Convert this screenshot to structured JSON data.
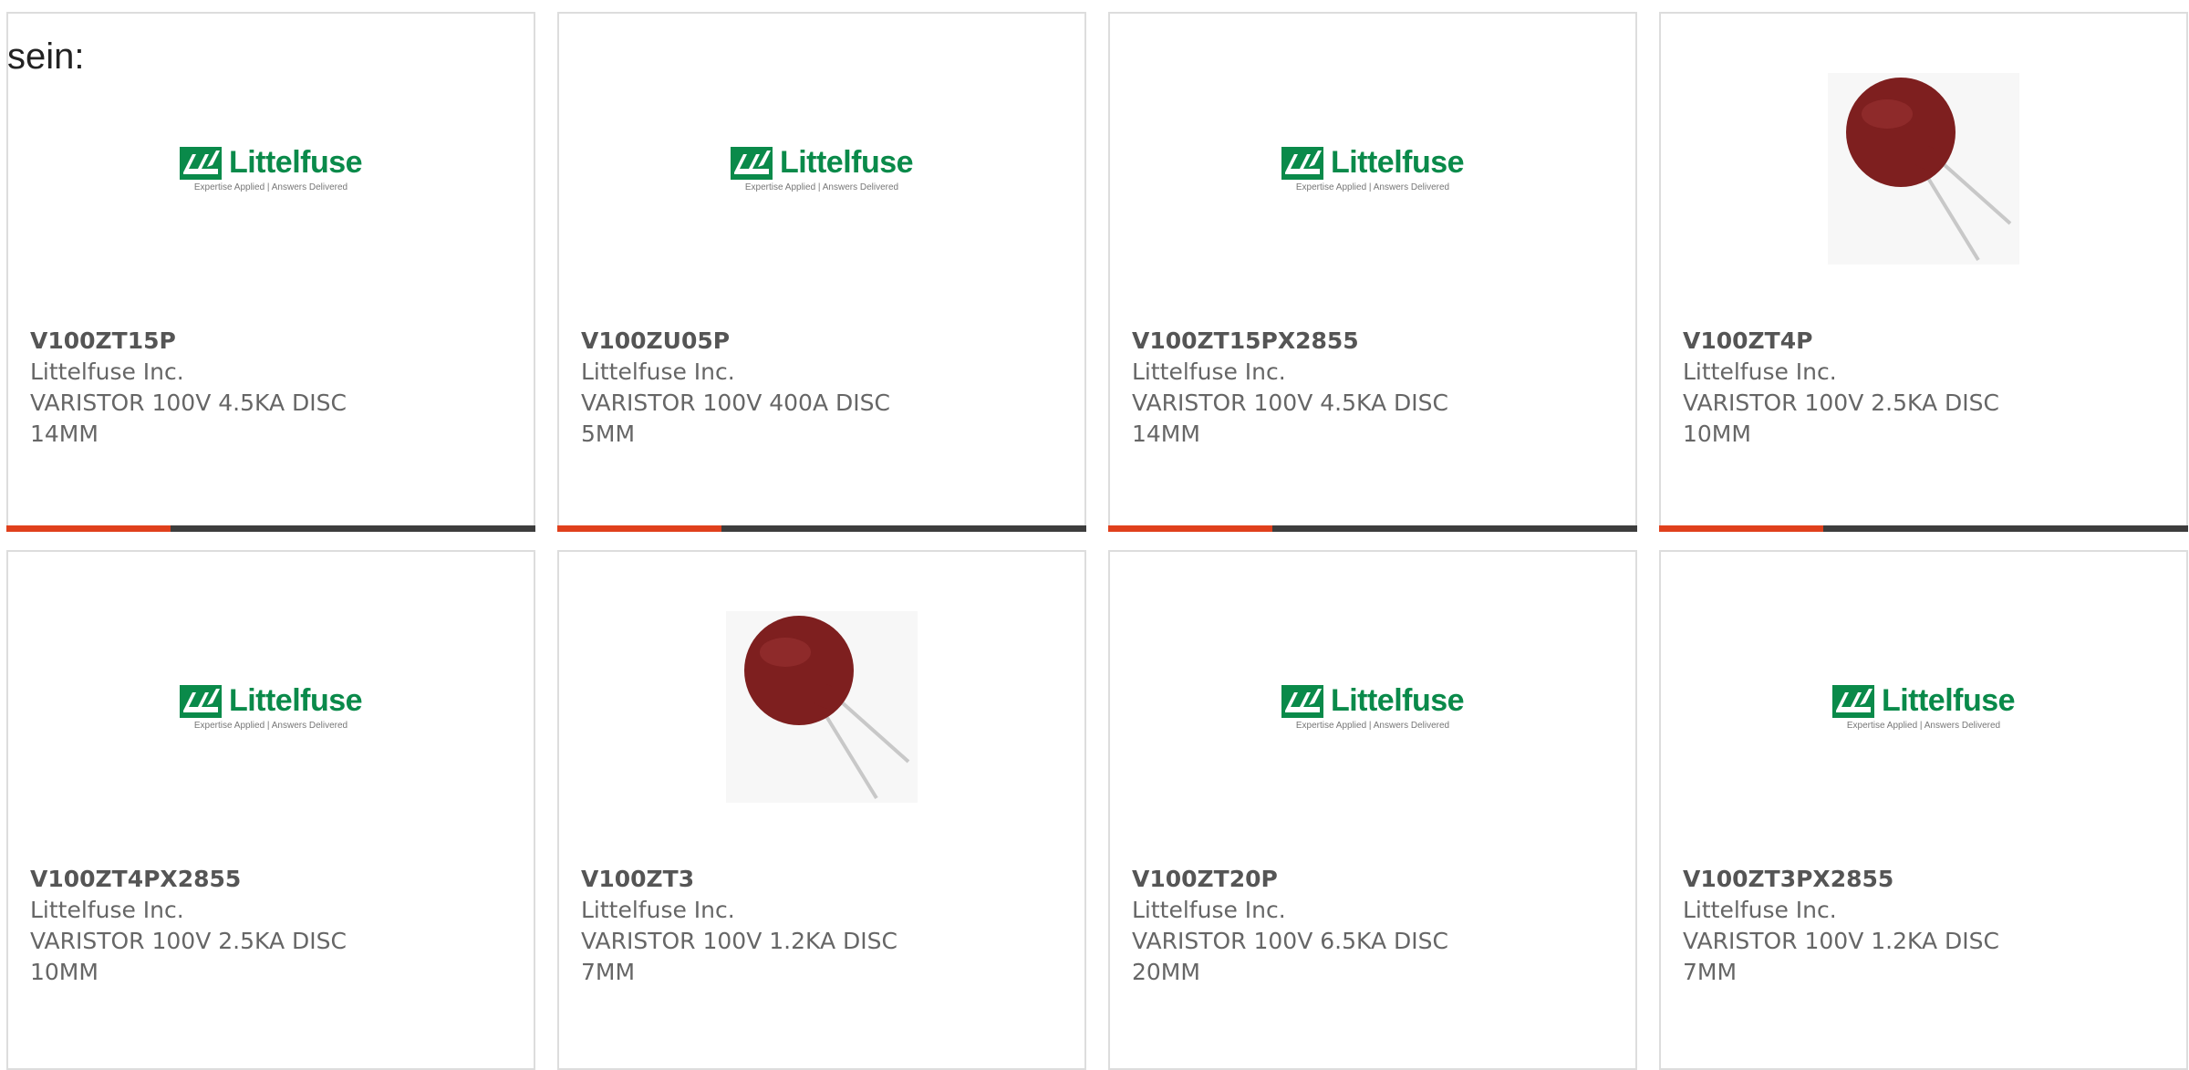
{
  "intro_text": "sein:",
  "accent_color": "#e0401c",
  "brand_color": "#0a8a4a",
  "logo": {
    "word": "Littelfuse",
    "tagline": "Expertise Applied | Answers Delivered"
  },
  "products": [
    {
      "part": "V100ZT15P",
      "mfr": "Littelfuse Inc.",
      "desc": "VARISTOR 100V 4.5KA DISC 14MM",
      "image": "littelfuse-logo",
      "progress": 0.31
    },
    {
      "part": "V100ZU05P",
      "mfr": "Littelfuse Inc.",
      "desc": "VARISTOR 100V 400A DISC 5MM",
      "image": "littelfuse-logo",
      "progress": 0.31
    },
    {
      "part": "V100ZT15PX2855",
      "mfr": "Littelfuse Inc.",
      "desc": "VARISTOR 100V 4.5KA DISC 14MM",
      "image": "littelfuse-logo",
      "progress": 0.31
    },
    {
      "part": "V100ZT4P",
      "mfr": "Littelfuse Inc.",
      "desc": "VARISTOR 100V 2.5KA DISC 10MM",
      "image": "varistor-photo",
      "progress": 0.31
    },
    {
      "part": "V100ZT4PX2855",
      "mfr": "Littelfuse Inc.",
      "desc": "VARISTOR 100V 2.5KA DISC 10MM",
      "image": "littelfuse-logo"
    },
    {
      "part": "V100ZT3",
      "mfr": "Littelfuse Inc.",
      "desc": "VARISTOR 100V 1.2KA DISC 7MM",
      "image": "varistor-photo"
    },
    {
      "part": "V100ZT20P",
      "mfr": "Littelfuse Inc.",
      "desc": "VARISTOR 100V 6.5KA DISC 20MM",
      "image": "littelfuse-logo"
    },
    {
      "part": "V100ZT3PX2855",
      "mfr": "Littelfuse Inc.",
      "desc": "VARISTOR 100V 1.2KA DISC 7MM",
      "image": "littelfuse-logo"
    }
  ]
}
